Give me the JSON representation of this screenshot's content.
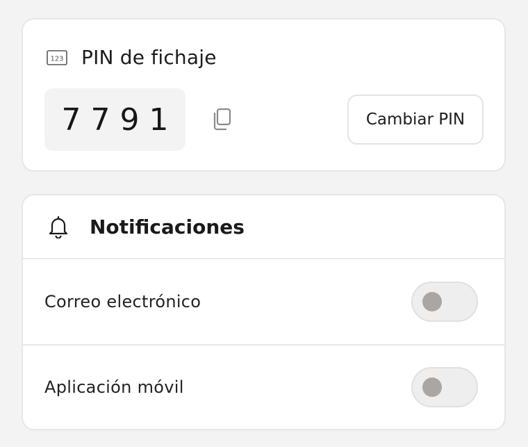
{
  "pin_card": {
    "title": "PIN de fichaje",
    "icon": "numbers-123-icon",
    "pin_value": "7791",
    "copy_icon": "copy-icon",
    "change_button_label": "Cambiar PIN"
  },
  "notifications": {
    "title": "Notificaciones",
    "icon": "bell-icon",
    "rows": [
      {
        "label": "Correo electrónico",
        "enabled": false
      },
      {
        "label": "Aplicación móvil",
        "enabled": false
      }
    ]
  },
  "colors": {
    "background": "#f3f3f3",
    "card": "#ffffff",
    "border": "#e6e6e6",
    "toggle_off_knob": "#a9a6a4"
  }
}
